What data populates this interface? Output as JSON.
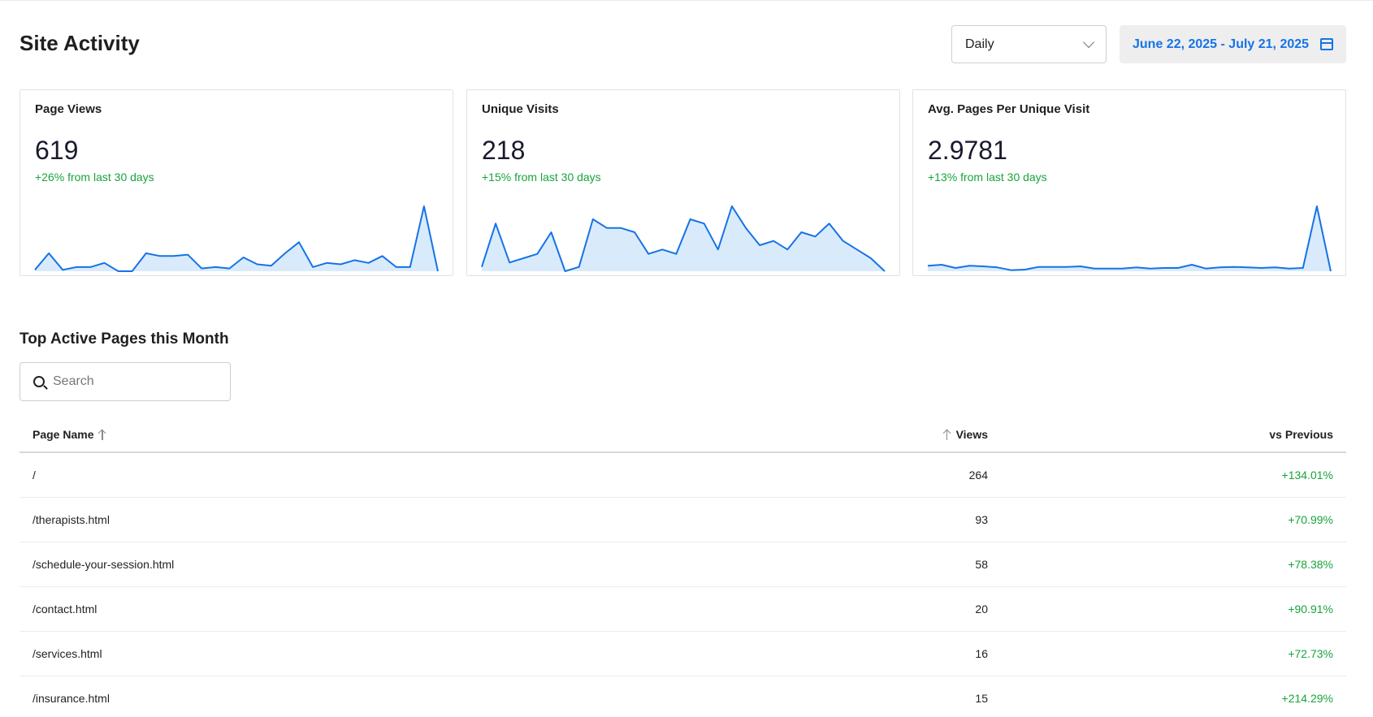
{
  "header": {
    "title": "Site Activity",
    "interval": "Daily",
    "date_range": "June 22, 2025 - July 21, 2025"
  },
  "cards": [
    {
      "title": "Page Views",
      "value": "619",
      "change": "+26% from last 30 days",
      "series": [
        1,
        13,
        1,
        3,
        3,
        6,
        0,
        0,
        13,
        11,
        11,
        12,
        2,
        3,
        2,
        10,
        5,
        4,
        13,
        21,
        3,
        6,
        5,
        8,
        6,
        11,
        3,
        3,
        47,
        0
      ]
    },
    {
      "title": "Unique Visits",
      "value": "218",
      "change": "+15% from last 30 days",
      "series": [
        1,
        11,
        2,
        3,
        4,
        9,
        0,
        1,
        12,
        10,
        10,
        9,
        4,
        5,
        4,
        12,
        11,
        5,
        15,
        10,
        6,
        7,
        5,
        9,
        8,
        11,
        7,
        5,
        3,
        0
      ]
    },
    {
      "title": "Avg. Pages Per Unique Visit",
      "value": "2.9781",
      "change": "+13% from last 30 days",
      "series": [
        1.0,
        1.2,
        0.6,
        1.0,
        0.9,
        0.7,
        0.2,
        0.3,
        0.8,
        0.8,
        0.8,
        0.9,
        0.5,
        0.5,
        0.5,
        0.7,
        0.5,
        0.6,
        0.6,
        1.2,
        0.5,
        0.7,
        0.8,
        0.7,
        0.6,
        0.7,
        0.5,
        0.6,
        12.0,
        0.0
      ]
    }
  ],
  "section": {
    "title": "Top Active Pages this Month",
    "search_placeholder": "Search"
  },
  "table": {
    "columns": {
      "name": "Page Name",
      "views": "Views",
      "vs": "vs Previous"
    },
    "rows": [
      {
        "name": "/",
        "views": "264",
        "vs": "+134.01%"
      },
      {
        "name": "/therapists.html",
        "views": "93",
        "vs": "+70.99%"
      },
      {
        "name": "/schedule-your-session.html",
        "views": "58",
        "vs": "+78.38%"
      },
      {
        "name": "/contact.html",
        "views": "20",
        "vs": "+90.91%"
      },
      {
        "name": "/services.html",
        "views": "16",
        "vs": "+72.73%"
      },
      {
        "name": "/insurance.html",
        "views": "15",
        "vs": "+214.29%"
      }
    ]
  },
  "colors": {
    "accent": "#1673e6",
    "positive": "#19a33c",
    "spark_fill": "#d9ebfb"
  }
}
